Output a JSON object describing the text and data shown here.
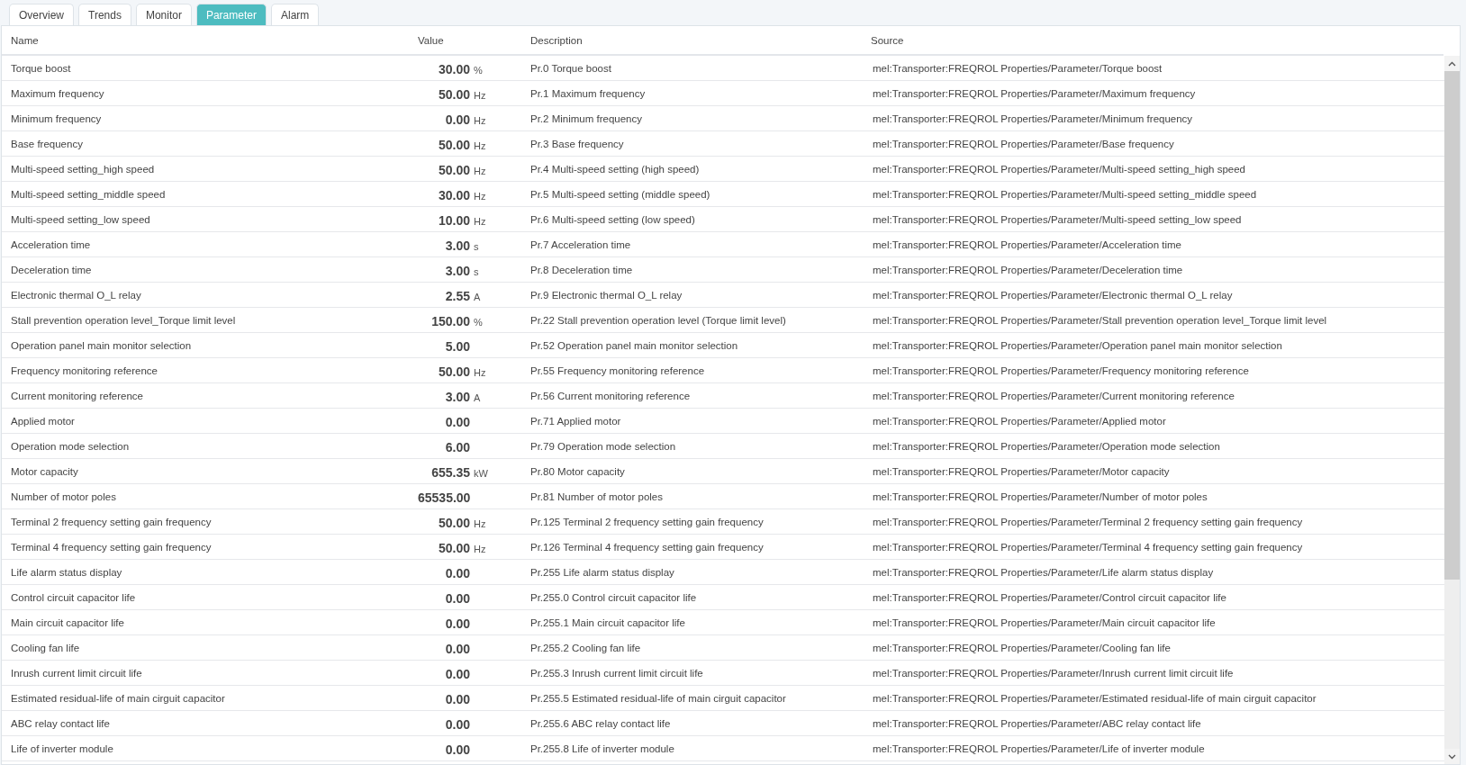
{
  "tabs": [
    {
      "label": "Overview",
      "selected": false
    },
    {
      "label": "Trends",
      "selected": false
    },
    {
      "label": "Monitor",
      "selected": false
    },
    {
      "label": "Parameter",
      "selected": true
    },
    {
      "label": "Alarm",
      "selected": false
    }
  ],
  "table": {
    "columns": [
      "Name",
      "Value",
      "Description",
      "Source"
    ],
    "rows": [
      {
        "name": "Torque boost",
        "value": "30.00",
        "unit": "%",
        "description": "Pr.0 Torque boost",
        "source": "mel:Transporter:FREQROL Properties/Parameter/Torque boost"
      },
      {
        "name": "Maximum frequency",
        "value": "50.00",
        "unit": "Hz",
        "description": "Pr.1 Maximum frequency",
        "source": "mel:Transporter:FREQROL Properties/Parameter/Maximum frequency"
      },
      {
        "name": "Minimum frequency",
        "value": "0.00",
        "unit": "Hz",
        "description": "Pr.2 Minimum frequency",
        "source": "mel:Transporter:FREQROL Properties/Parameter/Minimum frequency"
      },
      {
        "name": "Base frequency",
        "value": "50.00",
        "unit": "Hz",
        "description": "Pr.3 Base frequency",
        "source": "mel:Transporter:FREQROL Properties/Parameter/Base frequency"
      },
      {
        "name": "Multi-speed setting_high speed",
        "value": "50.00",
        "unit": "Hz",
        "description": "Pr.4 Multi-speed setting (high speed)",
        "source": "mel:Transporter:FREQROL Properties/Parameter/Multi-speed setting_high speed"
      },
      {
        "name": "Multi-speed setting_middle speed",
        "value": "30.00",
        "unit": "Hz",
        "description": "Pr.5 Multi-speed setting (middle speed)",
        "source": "mel:Transporter:FREQROL Properties/Parameter/Multi-speed setting_middle speed"
      },
      {
        "name": "Multi-speed setting_low speed",
        "value": "10.00",
        "unit": "Hz",
        "description": "Pr.6 Multi-speed setting (low speed)",
        "source": "mel:Transporter:FREQROL Properties/Parameter/Multi-speed setting_low speed"
      },
      {
        "name": "Acceleration time",
        "value": "3.00",
        "unit": "s",
        "description": "Pr.7 Acceleration time",
        "source": "mel:Transporter:FREQROL Properties/Parameter/Acceleration time"
      },
      {
        "name": "Deceleration time",
        "value": "3.00",
        "unit": "s",
        "description": "Pr.8 Deceleration time",
        "source": "mel:Transporter:FREQROL Properties/Parameter/Deceleration time"
      },
      {
        "name": "Electronic thermal O_L relay",
        "value": "2.55",
        "unit": "A",
        "description": "Pr.9 Electronic thermal O_L relay",
        "source": "mel:Transporter:FREQROL Properties/Parameter/Electronic thermal O_L relay"
      },
      {
        "name": "Stall prevention operation level_Torque limit level",
        "value": "150.00",
        "unit": "%",
        "description": "Pr.22 Stall prevention operation level (Torque limit level)",
        "source": "mel:Transporter:FREQROL Properties/Parameter/Stall prevention operation level_Torque limit level"
      },
      {
        "name": "Operation panel main monitor selection",
        "value": "5.00",
        "description": "Pr.52 Operation panel main monitor selection",
        "source": "mel:Transporter:FREQROL Properties/Parameter/Operation panel main monitor selection"
      },
      {
        "name": "Frequency monitoring reference",
        "value": "50.00",
        "unit": "Hz",
        "description": "Pr.55 Frequency monitoring reference",
        "source": "mel:Transporter:FREQROL Properties/Parameter/Frequency monitoring reference"
      },
      {
        "name": "Current monitoring reference",
        "value": "3.00",
        "unit": "A",
        "description": "Pr.56 Current monitoring reference",
        "source": "mel:Transporter:FREQROL Properties/Parameter/Current monitoring reference"
      },
      {
        "name": "Applied motor",
        "value": "0.00",
        "description": "Pr.71 Applied motor",
        "source": "mel:Transporter:FREQROL Properties/Parameter/Applied motor"
      },
      {
        "name": "Operation mode selection",
        "value": "6.00",
        "description": "Pr.79 Operation mode selection",
        "source": "mel:Transporter:FREQROL Properties/Parameter/Operation mode selection"
      },
      {
        "name": "Motor capacity",
        "value": "655.35",
        "unit": "kW",
        "description": "Pr.80 Motor capacity",
        "source": "mel:Transporter:FREQROL Properties/Parameter/Motor capacity"
      },
      {
        "name": "Number of motor poles",
        "value": "65535.00",
        "description": "Pr.81 Number of motor poles",
        "source": "mel:Transporter:FREQROL Properties/Parameter/Number of motor poles"
      },
      {
        "name": "Terminal 2 frequency setting gain frequency",
        "value": "50.00",
        "unit": "Hz",
        "description": "Pr.125 Terminal 2 frequency setting gain frequency",
        "source": "mel:Transporter:FREQROL Properties/Parameter/Terminal 2 frequency setting gain frequency"
      },
      {
        "name": "Terminal 4 frequency setting gain frequency",
        "value": "50.00",
        "unit": "Hz",
        "description": "Pr.126 Terminal 4 frequency setting gain frequency",
        "source": "mel:Transporter:FREQROL Properties/Parameter/Terminal 4 frequency setting gain frequency"
      },
      {
        "name": "Life alarm status display",
        "value": "0.00",
        "description": "Pr.255 Life alarm status display",
        "source": "mel:Transporter:FREQROL Properties/Parameter/Life alarm status display"
      },
      {
        "name": "Control circuit capacitor life",
        "value": "0.00",
        "description": "Pr.255.0 Control circuit capacitor life",
        "source": "mel:Transporter:FREQROL Properties/Parameter/Control circuit capacitor life"
      },
      {
        "name": "Main circuit capacitor life",
        "value": "0.00",
        "description": "Pr.255.1 Main circuit capacitor life",
        "source": "mel:Transporter:FREQROL Properties/Parameter/Main circuit capacitor life"
      },
      {
        "name": "Cooling fan life",
        "value": "0.00",
        "description": "Pr.255.2 Cooling fan life",
        "source": "mel:Transporter:FREQROL Properties/Parameter/Cooling fan life"
      },
      {
        "name": "Inrush current limit circuit life",
        "value": "0.00",
        "description": "Pr.255.3 Inrush current limit circuit life",
        "source": "mel:Transporter:FREQROL Properties/Parameter/Inrush current limit circuit life"
      },
      {
        "name": "Estimated residual-life of main cirguit capacitor",
        "value": "0.00",
        "description": "Pr.255.5 Estimated residual-life of main cirguit capacitor",
        "source": "mel:Transporter:FREQROL Properties/Parameter/Estimated residual-life of main cirguit capacitor"
      },
      {
        "name": "ABC relay contact life",
        "value": "0.00",
        "description": "Pr.255.6 ABC relay contact life",
        "source": "mel:Transporter:FREQROL Properties/Parameter/ABC relay contact life"
      },
      {
        "name": "Life of inverter module",
        "value": "0.00",
        "description": "Pr.255.8 Life of inverter module",
        "source": "mel:Transporter:FREQROL Properties/Parameter/Life of inverter module"
      }
    ]
  }
}
